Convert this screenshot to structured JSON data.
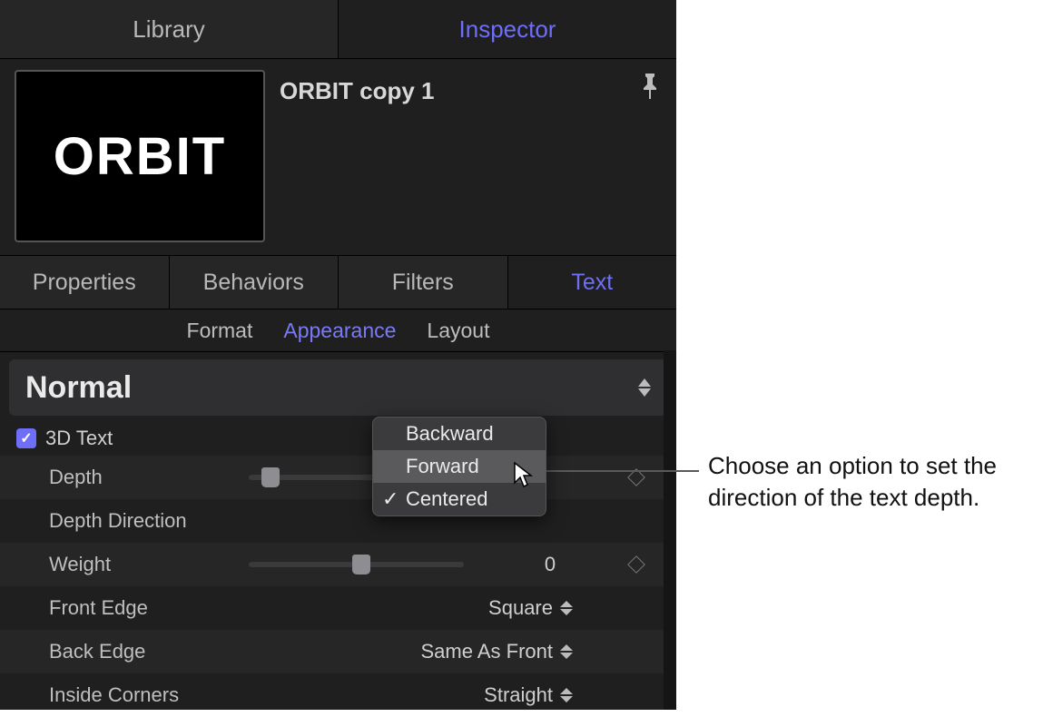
{
  "toptabs": {
    "library": "Library",
    "inspector": "Inspector"
  },
  "thumbnail_text": "ORBIT",
  "object_title": "ORBIT copy 1",
  "subtabs": {
    "properties": "Properties",
    "behaviors": "Behaviors",
    "filters": "Filters",
    "text": "Text"
  },
  "segments": {
    "format": "Format",
    "appearance": "Appearance",
    "layout": "Layout"
  },
  "style_popup": "Normal",
  "section_title": "3D Text",
  "params": {
    "depth": {
      "label": "Depth",
      "value": ""
    },
    "depth_direction": {
      "label": "Depth Direction"
    },
    "weight": {
      "label": "Weight",
      "value": "0"
    },
    "front_edge": {
      "label": "Front Edge",
      "value": "Square"
    },
    "back_edge": {
      "label": "Back Edge",
      "value": "Same As Front"
    },
    "inside_corners": {
      "label": "Inside Corners",
      "value": "Straight"
    }
  },
  "menu": {
    "backward": "Backward",
    "forward": "Forward",
    "centered": "Centered"
  },
  "callout": "Choose an option to set the direction of the text depth."
}
